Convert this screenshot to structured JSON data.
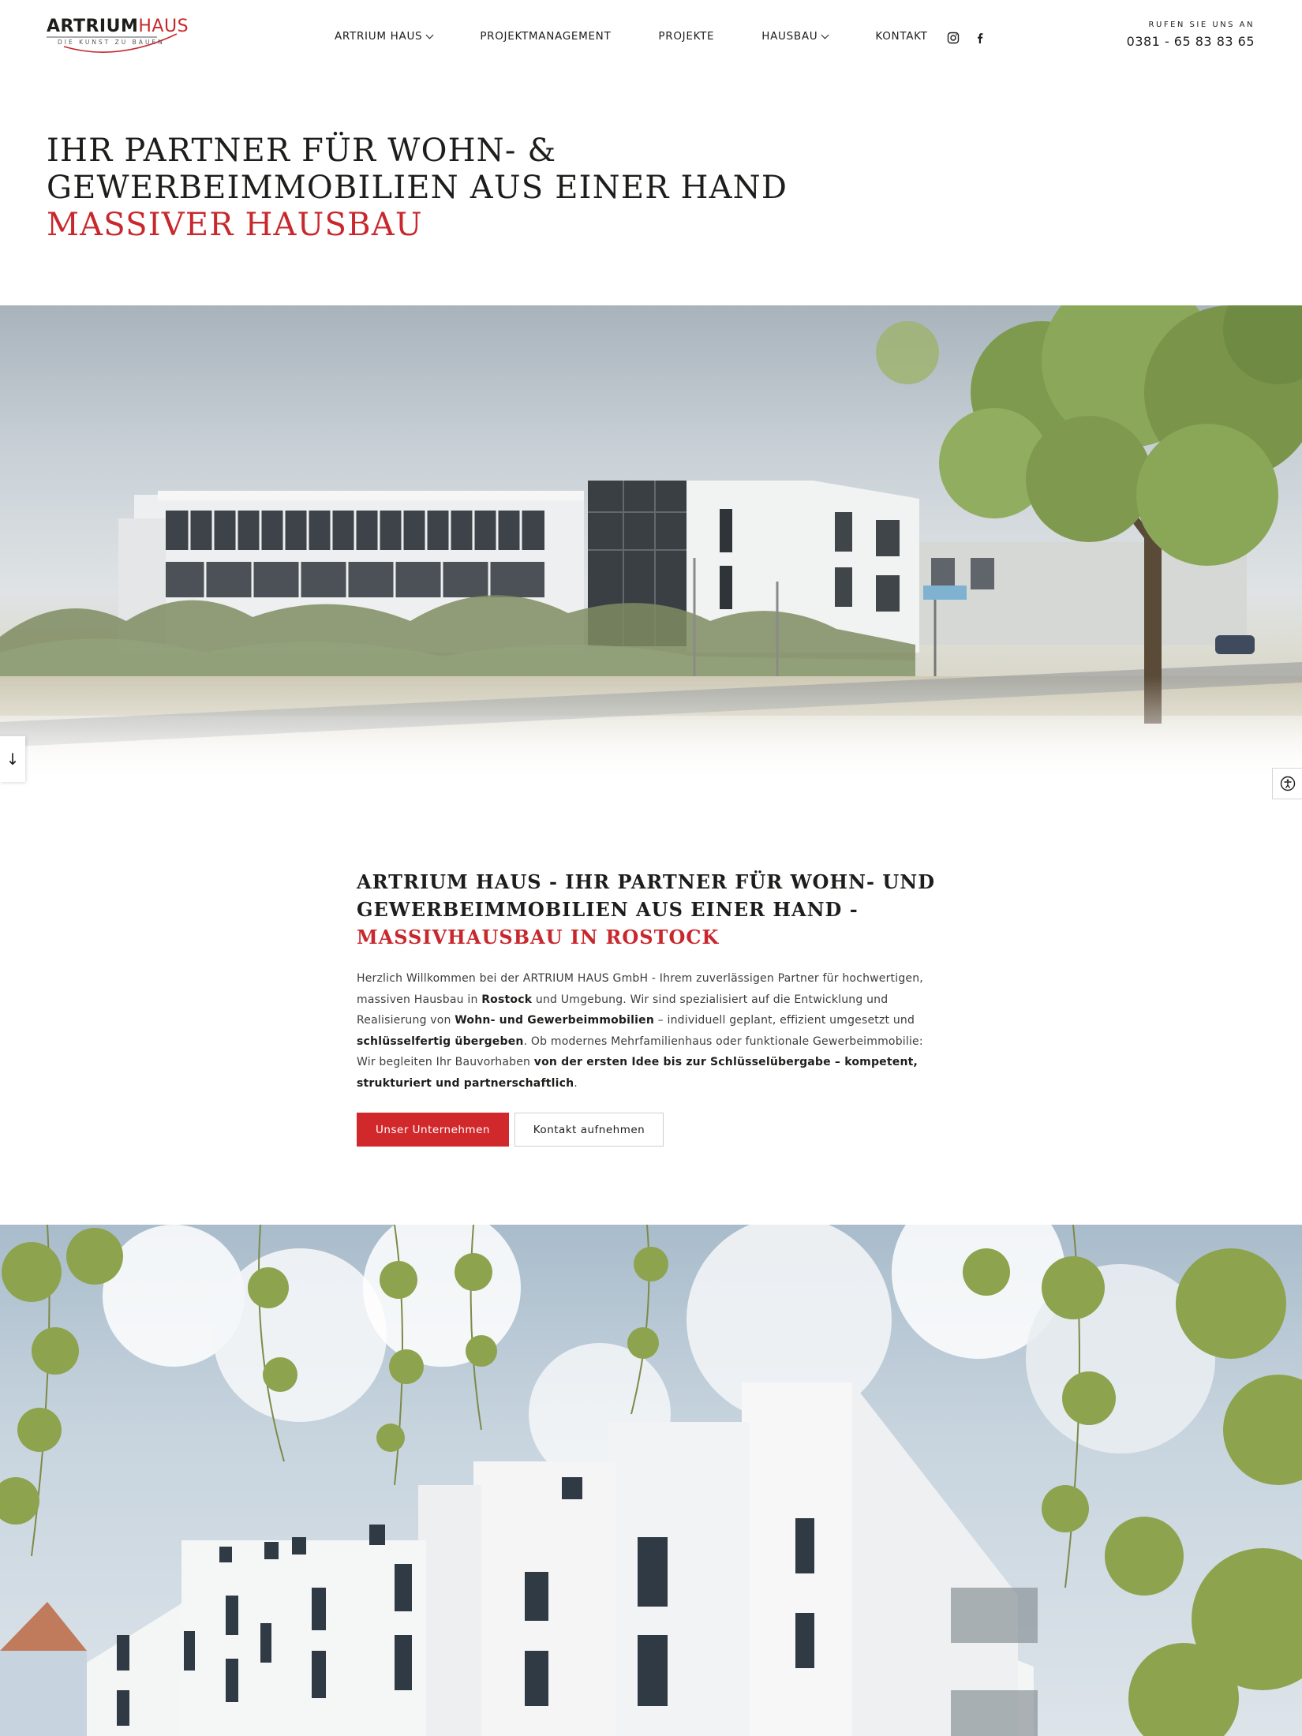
{
  "header": {
    "logo": {
      "word_dark": "ARTRIUM",
      "word_red": "HAUS",
      "tagline": "DIE KUNST ZU BAUEN"
    },
    "nav": [
      {
        "label": "ARTRIUM HAUS",
        "has_dropdown": true
      },
      {
        "label": "PROJEKTMANAGEMENT",
        "has_dropdown": false
      },
      {
        "label": "PROJEKTE",
        "has_dropdown": false
      },
      {
        "label": "HAUSBAU",
        "has_dropdown": true
      },
      {
        "label": "KONTAKT",
        "has_dropdown": false
      }
    ],
    "social_icons": [
      "instagram-icon",
      "facebook-icon"
    ],
    "call_label": "RUFEN SIE UNS AN",
    "phone": "0381 - 65 83 83 65"
  },
  "hero": {
    "line1": "IHR PARTNER FÜR WOHN- &",
    "line2": "GEWERBEIMMOBILIEN AUS EINER HAND",
    "accent": "MASSIVER HAUSBAU"
  },
  "side": {
    "scroll_arrow": "↓",
    "accessibility_icon": "accessibility-icon"
  },
  "intro": {
    "title_line1": "ARTRIUM HAUS - IHR PARTNER FÜR WOHN- UND",
    "title_line2": "GEWERBEIMMOBILIEN AUS EINER HAND -",
    "title_accent": "MASSIVHAUSBAU IN ROSTOCK",
    "text": [
      {
        "t": "Herzlich Willkommen bei der ARTRIUM HAUS GmbH - Ihrem zuverlässigen Partner für hochwertigen, massiven Hausbau in ",
        "b": false
      },
      {
        "t": "Rostock",
        "b": true
      },
      {
        "t": " und Umgebung. Wir sind spezialisiert auf die Entwicklung und Realisierung von ",
        "b": false
      },
      {
        "t": "Wohn- und Gewerbeimmobilien",
        "b": true
      },
      {
        "t": " – individuell geplant, effizient umgesetzt und ",
        "b": false
      },
      {
        "t": "schlüsselfertig übergeben",
        "b": true
      },
      {
        "t": ". Ob modernes Mehrfamilienhaus oder funktionale Gewerbeimmobilie: Wir begleiten Ihr Bauvorhaben ",
        "b": false
      },
      {
        "t": "von der ersten Idee bis zur Schlüsselübergabe – kompetent, strukturiert und partnerschaftlich",
        "b": true
      },
      {
        "t": ".",
        "b": false
      }
    ],
    "primary_button": "Unser Unternehmen",
    "secondary_button": "Kontakt aufnehmen"
  },
  "colors": {
    "accent": "#c8282d",
    "button": "#d1282c",
    "text": "#1d1d1b"
  }
}
